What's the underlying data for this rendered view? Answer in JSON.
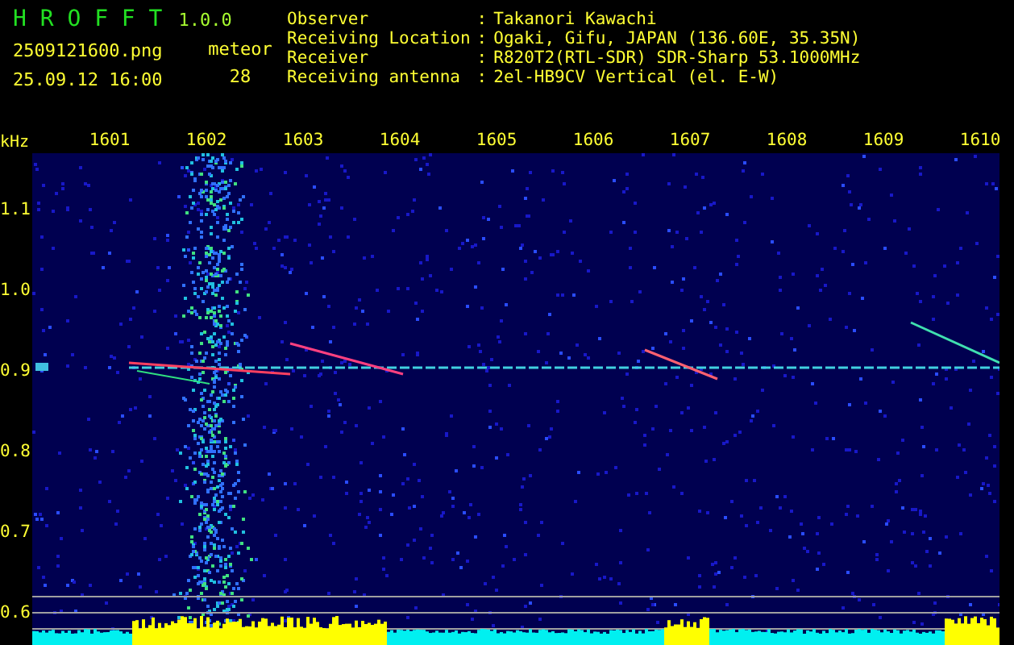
{
  "app": {
    "name": "H R O F F T",
    "version": "1.0.0",
    "file": "2509121600.png",
    "timestamp": "25.09.12 16:00",
    "count_label": "meteor",
    "count": "28"
  },
  "station": [
    {
      "label": "Observer",
      "separator": ":",
      "value": "Takanori Kawachi"
    },
    {
      "label": "Receiving Location",
      "separator": ":",
      "value": "Ogaki, Gifu, JAPAN (136.60E, 35.35N)"
    },
    {
      "label": "Receiver",
      "separator": ":",
      "value": "R820T2(RTL-SDR) SDR-Sharp 53.1000MHz"
    },
    {
      "label": "Receiving antenna",
      "separator": ":",
      "value": "2el-HB9CV Vertical (el. E-W)"
    }
  ],
  "spectrogram": {
    "unit": "kHz",
    "x_labels": [
      "1601",
      "1602",
      "1603",
      "1604",
      "1605",
      "1606",
      "1607",
      "1608",
      "1609",
      "1610"
    ],
    "y_labels": [
      "1.1",
      "1.0",
      "0.9",
      "0.8",
      "0.7",
      "0.6"
    ]
  }
}
